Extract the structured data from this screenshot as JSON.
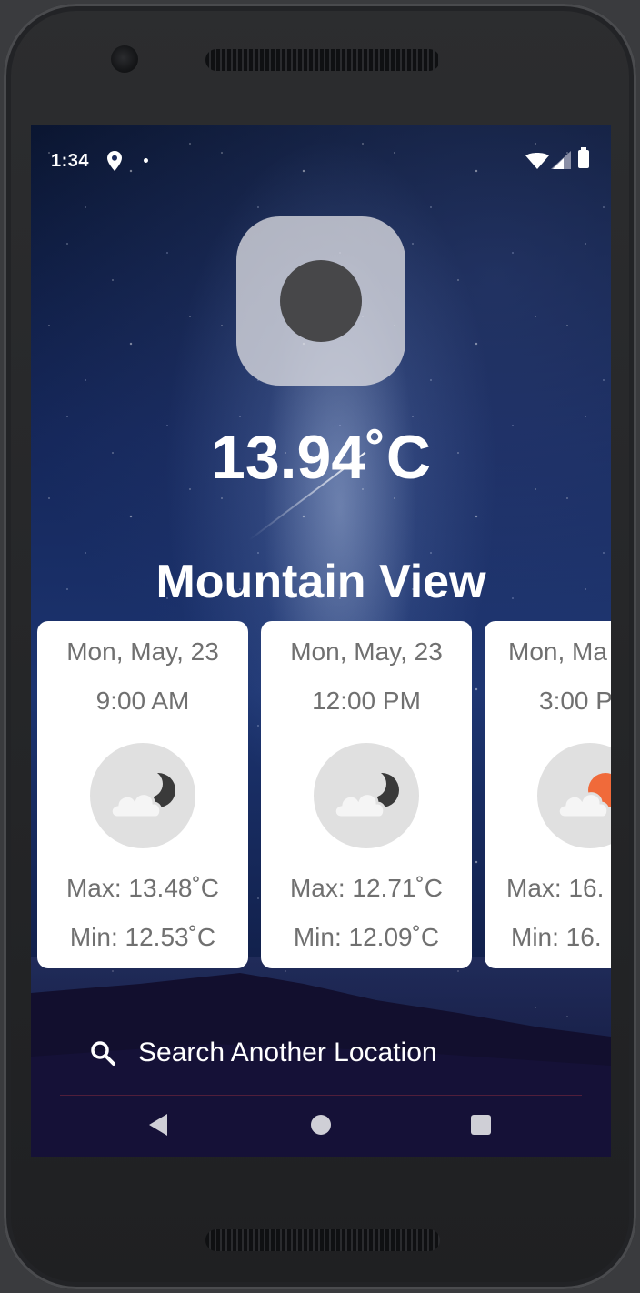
{
  "status_bar": {
    "time": "1:34",
    "icons": [
      "location-icon",
      "notification-dot-icon",
      "wifi-icon",
      "signal-icon",
      "battery-icon"
    ]
  },
  "current": {
    "icon": "weather-placeholder-icon",
    "temperature": "13.94˚C",
    "city": "Mountain View"
  },
  "forecast": [
    {
      "date": "Mon, May, 23",
      "time": "9:00 AM",
      "icon": "partly-cloudy-night-icon",
      "max": "Max: 13.48˚C",
      "min": "Min: 12.53˚C"
    },
    {
      "date": "Mon, May, 23",
      "time": "12:00 PM",
      "icon": "partly-cloudy-night-icon",
      "max": "Max: 12.71˚C",
      "min": "Min: 12.09˚C"
    },
    {
      "date": "Mon, Ma",
      "time": "3:00 P",
      "icon": "partly-cloudy-day-icon",
      "max": "Max: 16.",
      "min": "Min: 16."
    }
  ],
  "search": {
    "label": "Search Another Location",
    "icon": "search-icon"
  },
  "colors": {
    "card_text": "#707070",
    "icon_circle": "#e0e0e0",
    "moon": "#3a3a3a",
    "sun": "#f06a3a"
  }
}
